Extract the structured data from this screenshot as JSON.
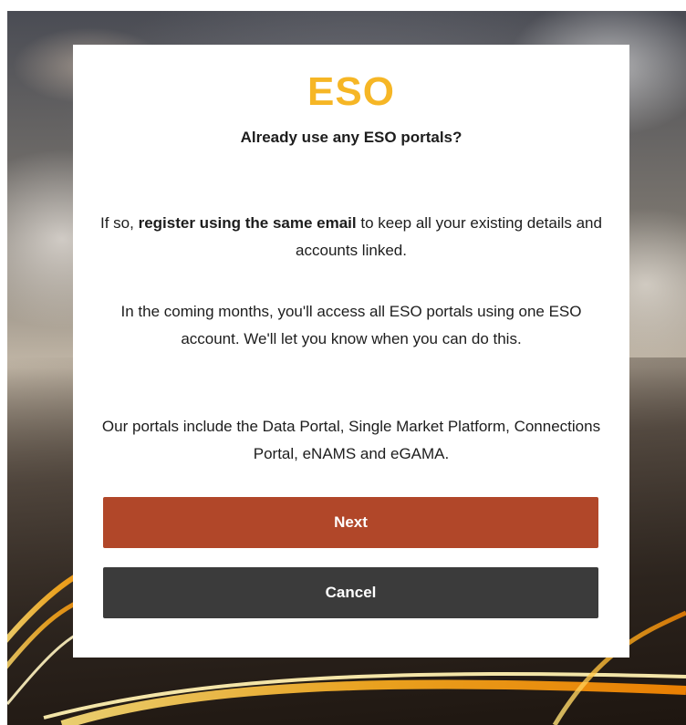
{
  "brand": {
    "logo_text": "ESO",
    "accent_color": "#f6b625"
  },
  "dialog": {
    "heading": "Already use any ESO portals?",
    "paragraph1": {
      "lead": "If so, ",
      "emphasis": "register using the same email",
      "tail": " to keep all your existing details and accounts linked."
    },
    "paragraph2": "In the coming months, you'll access all ESO portals using one ESO account. We'll let you know when you can do this.",
    "paragraph3": "Our portals include the Data Portal, Single Market Platform, Connections Portal, eNAMS and eGAMA."
  },
  "actions": {
    "next_label": "Next",
    "next_color": "#b14729",
    "cancel_label": "Cancel",
    "cancel_color": "#3b3b3b"
  }
}
